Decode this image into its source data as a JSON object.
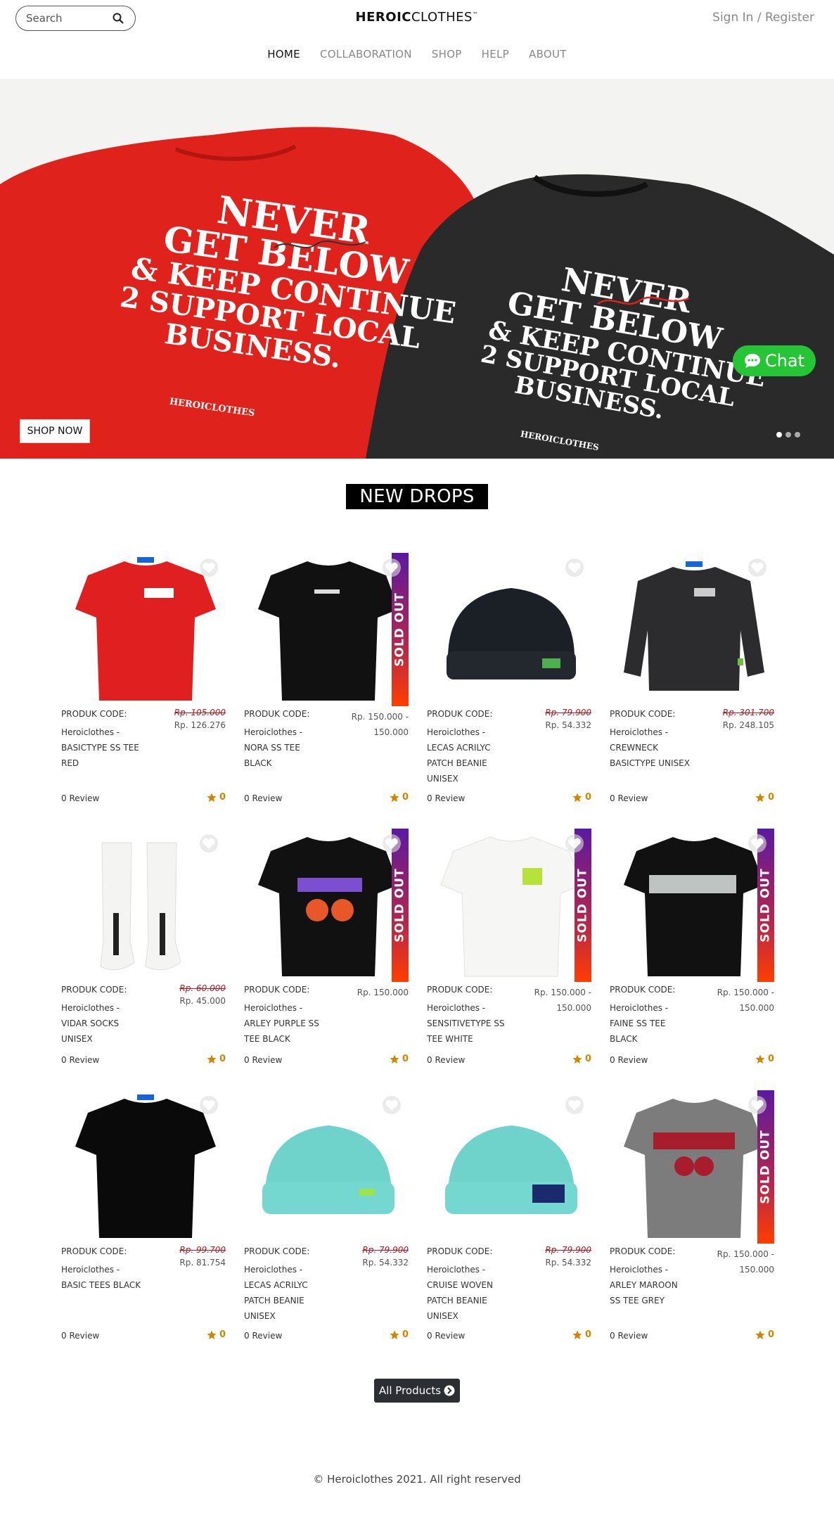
{
  "search": {
    "placeholder": "Search"
  },
  "brand": {
    "bold": "HEROIC",
    "light": "CLOTHES",
    "tm": "™"
  },
  "auth": {
    "sign_in": "Sign In",
    "separator": " / ",
    "register": "Register"
  },
  "nav": [
    {
      "label": "HOME",
      "active": true
    },
    {
      "label": "COLLABORATION",
      "active": false
    },
    {
      "label": "SHOP",
      "active": false
    },
    {
      "label": "HELP",
      "active": false
    },
    {
      "label": "ABOUT",
      "active": false
    }
  ],
  "hero": {
    "shop_now": "SHOP NOW",
    "slide_count": 3,
    "active_slide": 1,
    "shirt_text": [
      "NEVER",
      "GET BELOW",
      "& KEEP CONTINUE",
      "2 SUPPORT LOCAL",
      "BUSINESS."
    ],
    "shirt_brand": "HEROICLOTHES"
  },
  "chat": {
    "label": "Chat",
    "color": "#25c536"
  },
  "section": {
    "title": "NEW DROPS"
  },
  "products": [
    {
      "code_label": "PRODUK CODE:",
      "name": "Heroiclothes - BASICTYPE SS TEE RED",
      "name_lines": [
        "Heroiclothes -",
        "BASICTYPE SS TEE",
        "RED"
      ],
      "price_old": "Rp. 105.000",
      "price_new": "Rp. 126.276",
      "sold_out": false,
      "review": "0 Review",
      "rating": "0"
    },
    {
      "code_label": "PRODUK CODE:",
      "name": "Heroiclothes - NORA SS TEE BLACK",
      "name_lines": [
        "Heroiclothes -",
        "NORA SS TEE",
        "BLACK"
      ],
      "price_range": [
        "Rp. 150.000 -",
        "150.000"
      ],
      "sold_out": true,
      "review": "0 Review",
      "rating": "0"
    },
    {
      "code_label": "PRODUK CODE:",
      "name": "Heroiclothes - LECAS ACRILYC PATCH BEANIE UNISEX",
      "name_lines": [
        "Heroiclothes -",
        "LECAS ACRILYC",
        "PATCH BEANIE",
        "UNISEX"
      ],
      "price_old": "Rp. 79.900",
      "price_new": "Rp. 54.332",
      "sold_out": false,
      "review": "0 Review",
      "rating": "0"
    },
    {
      "code_label": "PRODUK CODE:",
      "name": "Heroiclothes - CREWNECK BASICTYPE UNISEX",
      "name_lines": [
        "Heroiclothes -",
        "CREWNECK",
        "BASICTYPE UNISEX"
      ],
      "price_old": "Rp. 301.700",
      "price_new": "Rp. 248.105",
      "sold_out": false,
      "review": "0 Review",
      "rating": "0"
    },
    {
      "code_label": "PRODUK CODE:",
      "name": "Heroiclothes - VIDAR SOCKS UNISEX",
      "name_lines": [
        "Heroiclothes -",
        "VIDAR SOCKS",
        "UNISEX"
      ],
      "price_old": "Rp. 60.000",
      "price_new": "Rp. 45.000",
      "sold_out": false,
      "review": "0 Review",
      "rating": "0"
    },
    {
      "code_label": "PRODUK CODE:",
      "name": "Heroiclothes - ARLEY PURPLE SS TEE BLACK",
      "name_lines": [
        "Heroiclothes -",
        "ARLEY PURPLE SS",
        "TEE BLACK"
      ],
      "price_range": [
        "Rp. 150.000"
      ],
      "sold_out": true,
      "review": "0 Review",
      "rating": "0"
    },
    {
      "code_label": "PRODUK CODE:",
      "name": "Heroiclothes - SENSITIVETYPE SS TEE WHITE",
      "name_lines": [
        "Heroiclothes -",
        "SENSITIVETYPE SS",
        "TEE WHITE"
      ],
      "price_range": [
        "Rp. 150.000 -",
        "150.000"
      ],
      "sold_out": true,
      "review": "0 Review",
      "rating": "0"
    },
    {
      "code_label": "PRODUK CODE:",
      "name": "Heroiclothes - FAINE SS TEE BLACK",
      "name_lines": [
        "Heroiclothes -",
        "FAINE SS TEE",
        "BLACK"
      ],
      "price_range": [
        "Rp. 150.000 -",
        "150.000"
      ],
      "sold_out": true,
      "review": "0 Review",
      "rating": "0"
    },
    {
      "code_label": "PRODUK CODE:",
      "name": "Heroiclothes - BASIC TEES BLACK",
      "name_lines": [
        "Heroiclothes -",
        "BASIC TEES BLACK"
      ],
      "price_old": "Rp. 99.700",
      "price_new": "Rp. 81.754",
      "sold_out": false,
      "review": "0 Review",
      "rating": "0"
    },
    {
      "code_label": "PRODUK CODE:",
      "name": "Heroiclothes - LECAS ACRILYC PATCH BEANIE UNISEX",
      "name_lines": [
        "Heroiclothes -",
        "LECAS ACRILYC",
        "PATCH BEANIE",
        "UNISEX"
      ],
      "price_old": "Rp. 79.900",
      "price_new": "Rp. 54.332",
      "sold_out": false,
      "review": "0 Review",
      "rating": "0"
    },
    {
      "code_label": "PRODUK CODE:",
      "name": "Heroiclothes - CRUISE WOVEN PATCH BEANIE UNISEX",
      "name_lines": [
        "Heroiclothes -",
        "CRUISE WOVEN",
        "PATCH BEANIE",
        "UNISEX"
      ],
      "price_old": "Rp. 79.900",
      "price_new": "Rp. 54.332",
      "sold_out": false,
      "review": "0 Review",
      "rating": "0"
    },
    {
      "code_label": "PRODUK CODE:",
      "name": "Heroiclothes - ARLEY MAROON SS TEE GREY",
      "name_lines": [
        "Heroiclothes -",
        "ARLEY MAROON",
        "SS TEE GREY"
      ],
      "price_range": [
        "Rp. 150.000 -",
        "150.000"
      ],
      "sold_out": true,
      "review": "0 Review",
      "rating": "0"
    }
  ],
  "sold_out_label": "SOLD OUT",
  "all_products": {
    "label": "All Products"
  },
  "footer": {
    "text": "© Heroiclothes 2021. All right reserved"
  },
  "colors": {
    "accent_star": "#d08600",
    "strike_price": "#b0171f",
    "button_dark": "#2b2f33"
  }
}
